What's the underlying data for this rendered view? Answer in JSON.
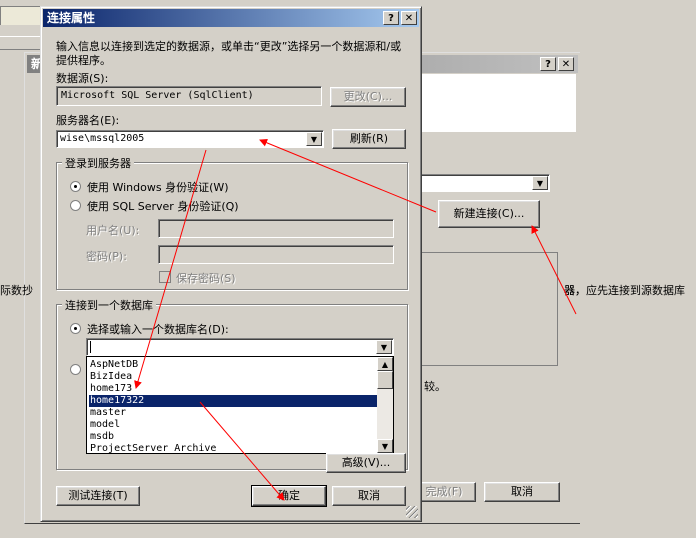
{
  "colors": {
    "titlebar_active": "#0a246a",
    "titlebar_inactive": "#808080",
    "arrow": "#ff0000",
    "selection": "#0a246a"
  },
  "background": {
    "left_text": "际数抄",
    "right_text": "器，应先连接到源数据库",
    "tail_text": "较。",
    "new_connection_label": "新建连接(C)...",
    "finish_label": "完成(F)",
    "cancel_label": "取消",
    "title_prefix": "新"
  },
  "dialog": {
    "title": "连接属性",
    "help_btn": "?",
    "close_btn": "✕",
    "intro": "输入信息以连接到选定的数据源，或单击“更改”选择另一个数据源和/或提供程序。",
    "datasource_label": "数据源(S):",
    "datasource_value": "Microsoft SQL Server (SqlClient)",
    "change_btn": "更改(C)...",
    "server_label": "服务器名(E):",
    "server_value": "wise\\mssql2005",
    "refresh_btn": "刷新(R)",
    "login_group": "登录到服务器",
    "auth_windows": "使用 Windows 身份验证(W)",
    "auth_sql": "使用 SQL Server 身份验证(Q)",
    "username_label": "用户名(U):",
    "password_label": "密码(P):",
    "save_password": "保存密码(S)",
    "db_group": "连接到一个数据库",
    "select_db_label": "选择或输入一个数据库名(D):",
    "db_value": "",
    "db_list": [
      "AspNetDB",
      "BizIdea",
      "home173",
      "home17322",
      "master",
      "model",
      "msdb",
      "ProjectServer_Archive"
    ],
    "selected_db": "home17322",
    "advanced_btn": "高级(V)...",
    "test_btn": "测试连接(T)",
    "ok_btn": "确定",
    "cancel_btn": "取消"
  }
}
